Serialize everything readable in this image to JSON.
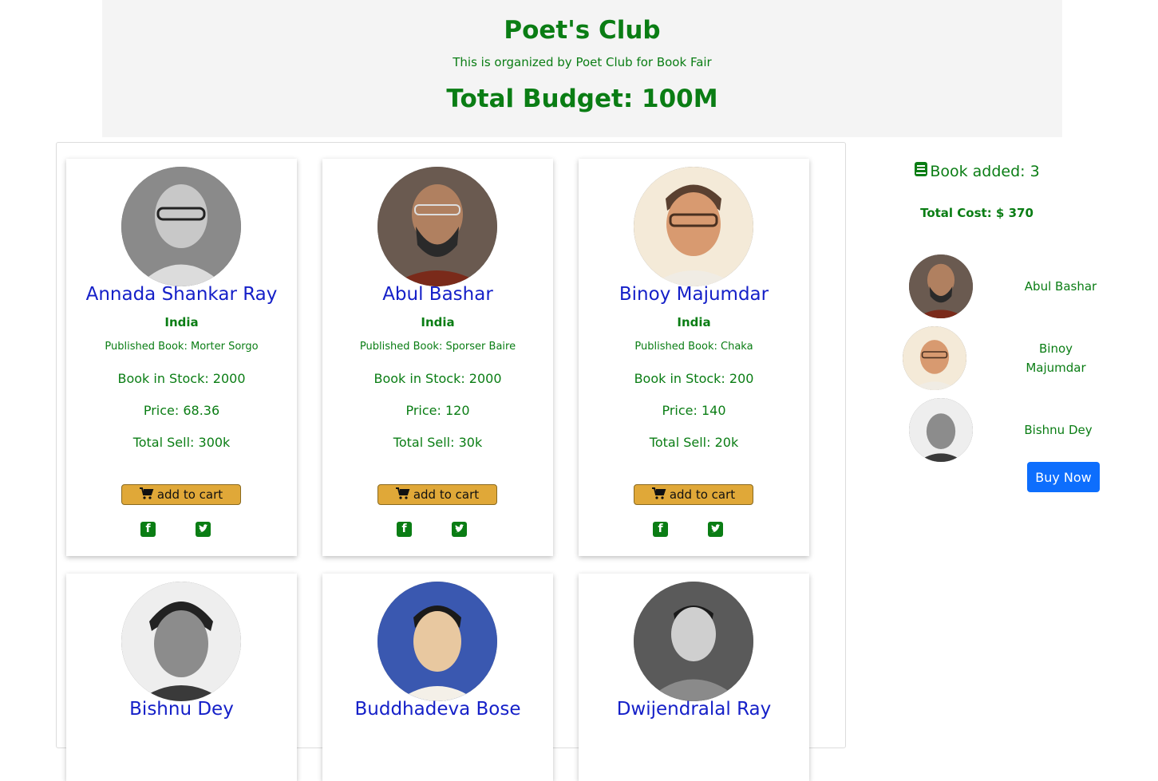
{
  "header": {
    "title": "Poet's Club",
    "subtitle": "This is organized by Poet Club for Book Fair",
    "budget": "Total Budget: 100M"
  },
  "icons": {
    "cart": "shopping-cart-icon",
    "facebook": "facebook-icon",
    "twitter": "twitter-icon",
    "book": "book-icon"
  },
  "colors": {
    "accent_green": "#0a7d14",
    "name_blue": "#1520c8",
    "cart_button": "#e0a838",
    "buy_button": "#0d6efd"
  },
  "poets": [
    {
      "name": "Annada Shankar Ray",
      "country": "India",
      "book": "Published Book: Morter Sorgo",
      "stock": "Book in Stock: 2000",
      "price": "Price: 68.36",
      "sell": "Total Sell: 300k",
      "cart_label": "add to cart"
    },
    {
      "name": "Abul Bashar",
      "country": "India",
      "book": "Published Book: Sporser Baire",
      "stock": "Book in Stock: 2000",
      "price": "Price: 120",
      "sell": "Total Sell: 30k",
      "cart_label": "add to cart"
    },
    {
      "name": "Binoy Majumdar",
      "country": "India",
      "book": "Published Book: Chaka",
      "stock": "Book in Stock: 200",
      "price": "Price: 140",
      "sell": "Total Sell: 20k",
      "cart_label": "add to cart"
    },
    {
      "name": "Bishnu Dey"
    },
    {
      "name": "Buddhadeva Bose"
    },
    {
      "name": "Dwijendralal Ray"
    }
  ],
  "cart": {
    "added": "Book added: 3",
    "total_cost": "Total Cost: $ 370",
    "items": [
      {
        "name": "Abul Bashar"
      },
      {
        "name": "Binoy Majumdar"
      },
      {
        "name": "Bishnu Dey"
      }
    ],
    "buy_label": "Buy Now"
  }
}
